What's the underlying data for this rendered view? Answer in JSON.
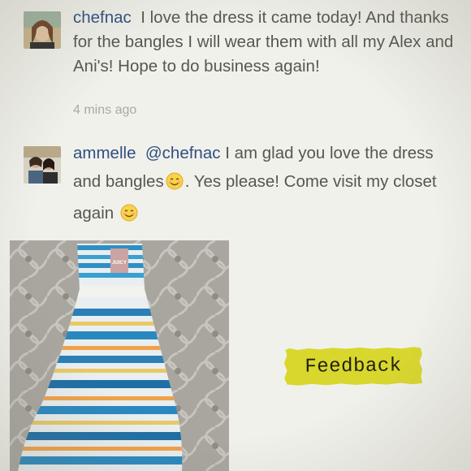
{
  "comments": [
    {
      "username": "chefnac",
      "text": "I love the dress it came today! And thanks for the bangles I will wear them with all my Alex and Ani's!  Hope to do business again!",
      "timestamp": "4 mins ago",
      "avatar_icon": "user-avatar-icon"
    },
    {
      "username": "ammelle",
      "mention": "@chefnac",
      "text_part1": "I am glad you love the dress and bangles",
      "text_part2": ". Yes please!  Come visit my closet again",
      "emoji_icon": "smiley-face-icon",
      "avatar_icon": "user-avatar-icon"
    }
  ],
  "photo": {
    "tag_label": "JUICY",
    "description_icon": "striped-dress-photo"
  },
  "feedback_label": "Feedback",
  "colors": {
    "username": "#2f4f80",
    "body_text": "#55584f",
    "timestamp": "#a7aba1",
    "tape": "#d9d72e"
  }
}
